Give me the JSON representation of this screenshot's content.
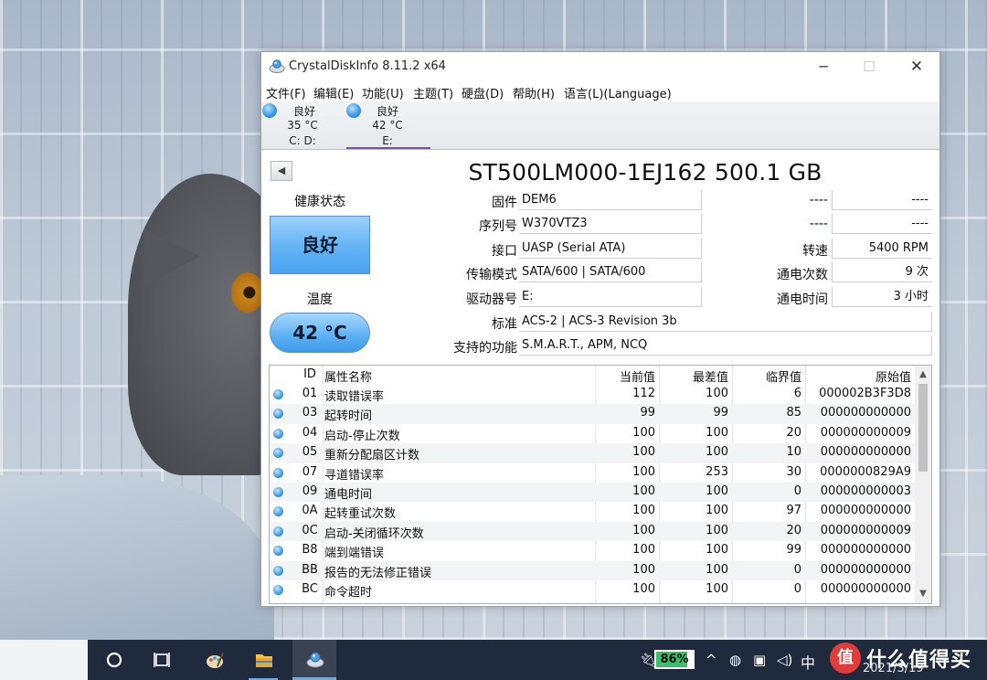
{
  "window": {
    "title": "CrystalDiskInfo 8.11.2 x64",
    "minimize": "─",
    "maximize": "☐",
    "close": "✕"
  },
  "menu": [
    "文件(F)",
    "编辑(E)",
    "功能(U)",
    "主题(T)",
    "硬盘(D)",
    "帮助(H)",
    "语言(L)(Language)"
  ],
  "disks": [
    {
      "status": "良好",
      "temp": "35 °C",
      "drive": "C: D:",
      "active": false
    },
    {
      "status": "良好",
      "temp": "42 °C",
      "drive": "E:",
      "active": true
    }
  ],
  "back_button": "◀",
  "disk_title": "ST500LM000-1EJ162 500.1 GB",
  "health": {
    "label": "健康状态",
    "value": "良好",
    "color": "#62b2f4"
  },
  "temperature": {
    "label": "温度",
    "value": "42 °C"
  },
  "info": {
    "firmware": {
      "label": "固件",
      "value": "DEM6"
    },
    "serial": {
      "label": "序列号",
      "value": "W370VTZ3"
    },
    "interface": {
      "label": "接口",
      "value": "UASP (Serial ATA)"
    },
    "transfer": {
      "label": "传输模式",
      "value": "SATA/600 | SATA/600"
    },
    "drive_letter": {
      "label": "驱动器号",
      "value": "E:"
    },
    "standard": {
      "label": "标准",
      "value": "ACS-2 | ACS-3 Revision 3b"
    },
    "features": {
      "label": "支持的功能",
      "value": "S.M.A.R.T., APM, NCQ"
    }
  },
  "right_info": {
    "r1": {
      "label": "----",
      "value": "----"
    },
    "r2": {
      "label": "----",
      "value": "----"
    },
    "rotation": {
      "label": "转速",
      "value": "5400 RPM"
    },
    "power_count": {
      "label": "通电次数",
      "value": "9 次"
    },
    "power_hours": {
      "label": "通电时间",
      "value": "3 小时"
    }
  },
  "smart": {
    "headers": {
      "id": "ID",
      "name": "属性名称",
      "current": "当前值",
      "worst": "最差值",
      "threshold": "临界值",
      "raw": "原始值"
    },
    "rows": [
      {
        "id": "01",
        "name": "读取错误率",
        "current": "112",
        "worst": "100",
        "threshold": "6",
        "raw": "000002B3F3D8"
      },
      {
        "id": "03",
        "name": "起转时间",
        "current": "99",
        "worst": "99",
        "threshold": "85",
        "raw": "000000000000"
      },
      {
        "id": "04",
        "name": "启动-停止次数",
        "current": "100",
        "worst": "100",
        "threshold": "20",
        "raw": "000000000009"
      },
      {
        "id": "05",
        "name": "重新分配扇区计数",
        "current": "100",
        "worst": "100",
        "threshold": "10",
        "raw": "000000000000"
      },
      {
        "id": "07",
        "name": "寻道错误率",
        "current": "100",
        "worst": "253",
        "threshold": "30",
        "raw": "0000000829A9"
      },
      {
        "id": "09",
        "name": "通电时间",
        "current": "100",
        "worst": "100",
        "threshold": "0",
        "raw": "000000000003"
      },
      {
        "id": "0A",
        "name": "起转重试次数",
        "current": "100",
        "worst": "100",
        "threshold": "97",
        "raw": "000000000000"
      },
      {
        "id": "0C",
        "name": "启动-关闭循环次数",
        "current": "100",
        "worst": "100",
        "threshold": "20",
        "raw": "000000000009"
      },
      {
        "id": "B8",
        "name": "端到端错误",
        "current": "100",
        "worst": "100",
        "threshold": "99",
        "raw": "000000000000"
      },
      {
        "id": "BB",
        "name": "报告的无法修正错误",
        "current": "100",
        "worst": "100",
        "threshold": "0",
        "raw": "000000000000"
      },
      {
        "id": "BC",
        "name": "命令超时",
        "current": "100",
        "worst": "100",
        "threshold": "0",
        "raw": "000000000000"
      }
    ]
  },
  "taskbar": {
    "battery_percent": "86%",
    "battery_level": 0.86,
    "ime": "中",
    "date": "2021/3/19",
    "watermark_badge": "值",
    "watermark_text": "什么值得买",
    "icons": [
      "cortana-icon",
      "task-view-icon",
      "paint-icon",
      "file-explorer-icon",
      "crystaldiskinfo-icon"
    ]
  }
}
